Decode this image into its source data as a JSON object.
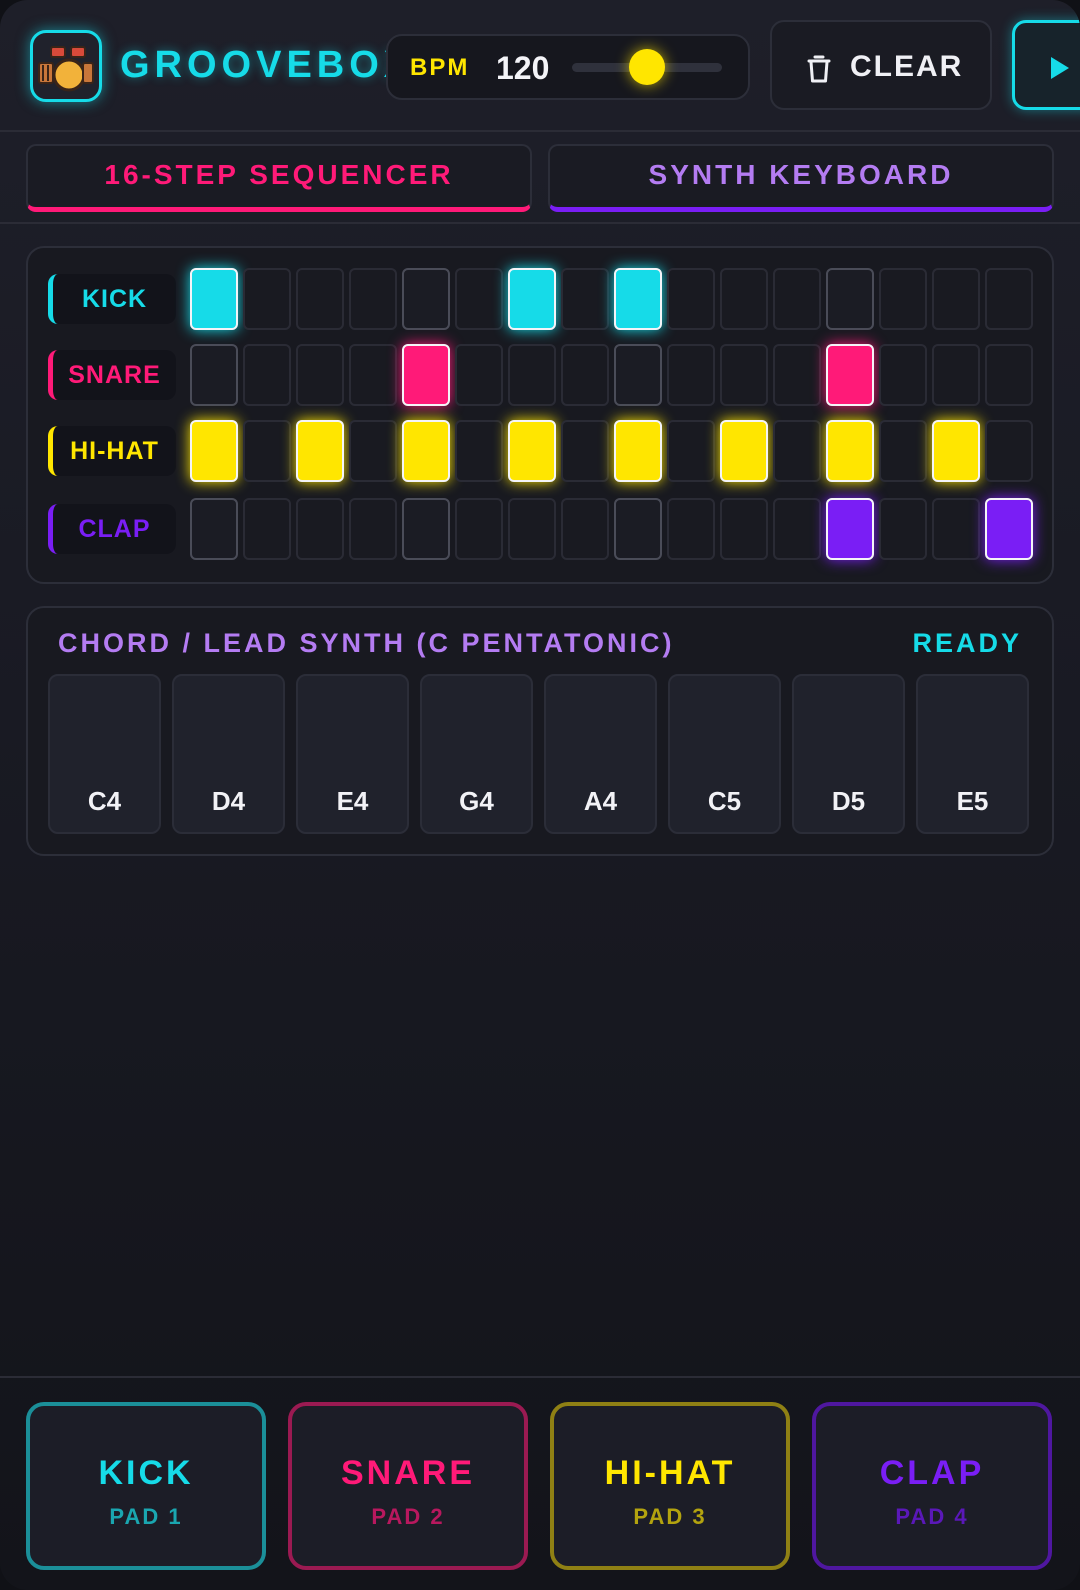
{
  "header": {
    "title": "GROOVEBOX",
    "bpm_label": "BPM",
    "bpm_value": "120",
    "bpm_slider_fraction": 0.5,
    "clear_label": "CLEAR",
    "logo_icon": "drum-kit-icon",
    "clear_icon": "trash-icon",
    "play_icon": "play-icon"
  },
  "tabs": [
    {
      "label": "16-STEP SEQUENCER",
      "active": true,
      "color": "#ff1a78"
    },
    {
      "label": "SYNTH KEYBOARD",
      "active": false,
      "color": "#7a1ef5"
    }
  ],
  "sequencer": {
    "steps": 16,
    "tracks": [
      {
        "name": "KICK",
        "color": "#16dbe8",
        "active_steps": [
          1,
          7,
          9
        ]
      },
      {
        "name": "SNARE",
        "color": "#ff1a78",
        "active_steps": [
          5,
          13
        ]
      },
      {
        "name": "HI-HAT",
        "color": "#ffe600",
        "active_steps": [
          1,
          3,
          5,
          7,
          9,
          11,
          13,
          15
        ]
      },
      {
        "name": "CLAP",
        "color": "#7a1ef5",
        "active_steps": [
          13,
          16
        ]
      }
    ]
  },
  "synth": {
    "title": "CHORD / LEAD SYNTH (C PENTATONIC)",
    "status": "READY",
    "keys": [
      "C4",
      "D4",
      "E4",
      "G4",
      "A4",
      "C5",
      "D5",
      "E5"
    ]
  },
  "pads": [
    {
      "name": "KICK",
      "sub": "PAD 1",
      "color": "#16dbe8",
      "border": "#1b8f99",
      "sub_color": "#1aa6b0"
    },
    {
      "name": "SNARE",
      "sub": "PAD 2",
      "color": "#ff1a78",
      "border": "#9b1a52",
      "sub_color": "#b8185e"
    },
    {
      "name": "HI-HAT",
      "sub": "PAD 3",
      "color": "#ffe600",
      "border": "#8f8014",
      "sub_color": "#b3a30f"
    },
    {
      "name": "CLAP",
      "sub": "PAD 4",
      "color": "#7a1ef5",
      "border": "#4f17a0",
      "sub_color": "#5a18b8"
    }
  ]
}
